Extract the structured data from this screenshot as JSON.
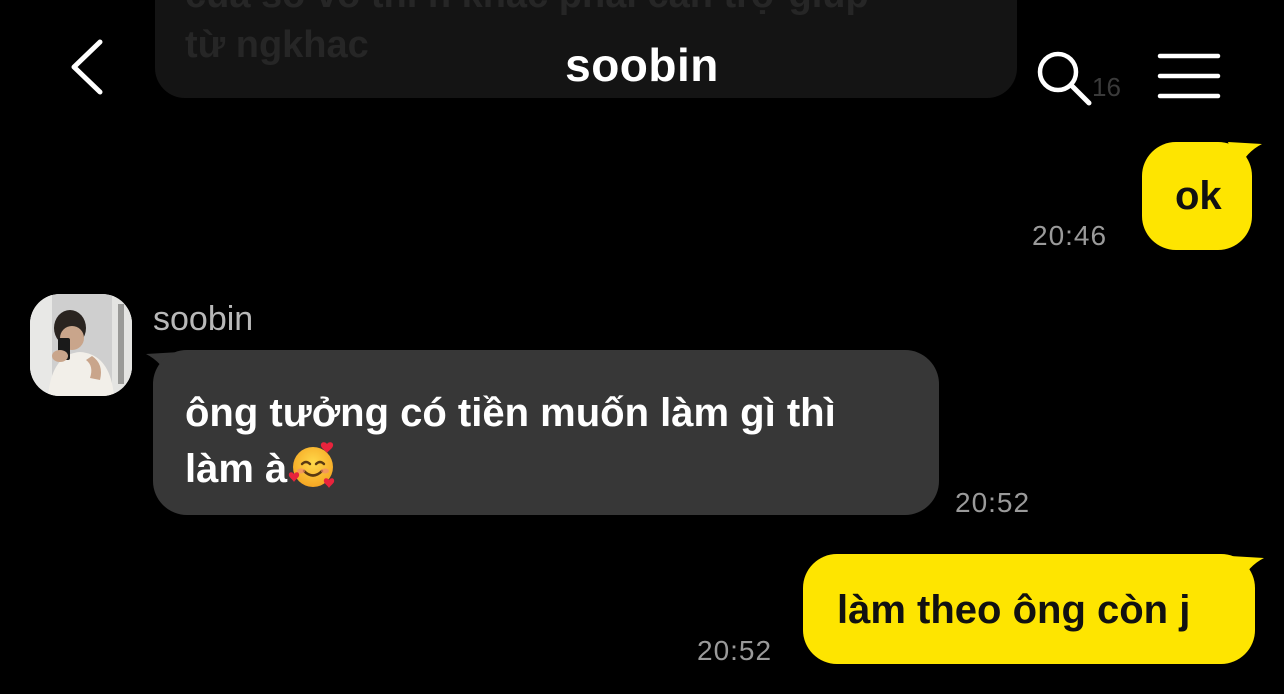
{
  "header": {
    "title": "soobin",
    "back_icon": "chevron-left-icon",
    "search_icon": "search-icon",
    "menu_icon": "hamburger-menu-icon"
  },
  "faded_message": {
    "text": "của sổ vô thì n khác phải cần trợ giúp\ntừ ngkhac",
    "time": "16"
  },
  "messages": [
    {
      "direction": "outgoing",
      "text": "ok",
      "time": "20:46"
    },
    {
      "direction": "incoming",
      "sender": "soobin",
      "text_line1": "ông tưởng có tiền muốn làm gì thì",
      "text_line2": "làm à",
      "emoji": "smiling-face-with-hearts",
      "time": "20:52"
    },
    {
      "direction": "outgoing",
      "text": "làm theo ông còn j",
      "time": "20:52"
    }
  ],
  "colors": {
    "background": "#000000",
    "outgoing_bubble": "#fee500",
    "incoming_bubble": "#373737",
    "timestamp": "#9a9a9a"
  }
}
